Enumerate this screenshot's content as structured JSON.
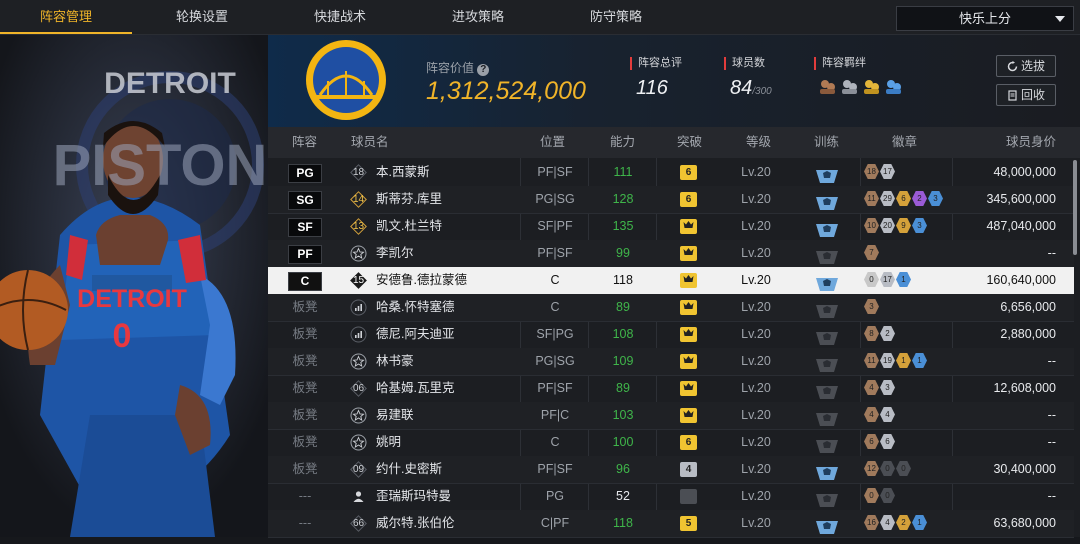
{
  "nav": {
    "tabs": [
      {
        "label": "阵容管理",
        "active": true
      },
      {
        "label": "轮换设置",
        "active": false
      },
      {
        "label": "快捷战术",
        "active": false
      },
      {
        "label": "进攻策略",
        "active": false
      },
      {
        "label": "防守策略",
        "active": false
      }
    ],
    "dropdown_value": "快乐上分"
  },
  "header": {
    "value_label": "阵容价值",
    "value": "1,312,524,000",
    "rating_label": "阵容总评",
    "rating": "116",
    "players_label": "球员数",
    "players": "84",
    "players_max": "/300",
    "bond_label": "阵容羁绊",
    "btn_select": "选拔",
    "btn_recycle": "回收"
  },
  "table": {
    "headers": [
      "阵容",
      "球员名",
      "位置",
      "能力",
      "突破",
      "等级",
      "训练",
      "徽章",
      "球员身价"
    ],
    "rows": [
      {
        "slot": "PG",
        "num": "18",
        "name": "本.西蒙斯",
        "pos": "PF|SF",
        "ability": "111",
        "break": "6",
        "level": "Lv.20",
        "train": true,
        "badges": [
          [
            "18",
            "#a07a5c"
          ],
          [
            "17",
            "#b8bcc4"
          ]
        ],
        "salary": "48,000,000"
      },
      {
        "slot": "SG",
        "num": "14",
        "name": "斯蒂芬.库里",
        "pos": "PG|SG",
        "ability": "128",
        "break": "6",
        "level": "Lv.20",
        "train": true,
        "badges": [
          [
            "11",
            "#a07a5c"
          ],
          [
            "29",
            "#b8bcc4"
          ],
          [
            "6",
            "#d4a13a"
          ],
          [
            "2",
            "#9a5bd6"
          ],
          [
            "3",
            "#4a8fd6"
          ]
        ],
        "salary": "345,600,000"
      },
      {
        "slot": "SF",
        "num": "13",
        "name": "凯文.杜兰特",
        "pos": "SF|PF",
        "ability": "135",
        "break": "crown",
        "level": "Lv.20",
        "train": true,
        "badges": [
          [
            "10",
            "#a07a5c"
          ],
          [
            "20",
            "#b8bcc4"
          ],
          [
            "9",
            "#d4a13a"
          ],
          [
            "3",
            "#4a8fd6"
          ]
        ],
        "salary": "487,040,000"
      },
      {
        "slot": "PF",
        "num": "star",
        "name": "李凯尔",
        "pos": "PF|SF",
        "ability": "99",
        "break": "crown",
        "level": "Lv.20",
        "train": false,
        "badges": [
          [
            "7",
            "#a07a5c"
          ]
        ],
        "salary": "--"
      },
      {
        "slot": "C",
        "num": "15",
        "name": "安德鲁.德拉蒙德",
        "pos": "C",
        "ability": "118",
        "break": "crown",
        "level": "Lv.20",
        "train": true,
        "badges": [
          [
            "0",
            "#c8c8c8"
          ],
          [
            "17",
            "#b8bcc4"
          ],
          [
            "1",
            "#4a8fd6"
          ]
        ],
        "salary": "160,640,000",
        "selected": true
      },
      {
        "slot": "板凳",
        "num": "bars",
        "name": "哈桑.怀特塞德",
        "pos": "C",
        "ability": "89",
        "break": "crown",
        "level": "Lv.20",
        "train": false,
        "badges": [
          [
            "3",
            "#a07a5c"
          ]
        ],
        "salary": "6,656,000"
      },
      {
        "slot": "板凳",
        "num": "bars",
        "name": "德尼.阿夫迪亚",
        "pos": "SF|PG",
        "ability": "108",
        "break": "crown",
        "level": "Lv.20",
        "train": false,
        "badges": [
          [
            "8",
            "#a07a5c"
          ],
          [
            "2",
            "#b8bcc4"
          ]
        ],
        "salary": "2,880,000"
      },
      {
        "slot": "板凳",
        "num": "star",
        "name": "林书豪",
        "pos": "PG|SG",
        "ability": "109",
        "break": "crown",
        "level": "Lv.20",
        "train": false,
        "badges": [
          [
            "11",
            "#a07a5c"
          ],
          [
            "19",
            "#b8bcc4"
          ],
          [
            "1",
            "#d4a13a"
          ],
          [
            "1",
            "#4a8fd6"
          ]
        ],
        "salary": "--"
      },
      {
        "slot": "板凳",
        "num": "06",
        "name": "哈基姆.瓦里克",
        "pos": "PF|SF",
        "ability": "89",
        "break": "crown",
        "level": "Lv.20",
        "train": false,
        "badges": [
          [
            "4",
            "#a07a5c"
          ],
          [
            "3",
            "#b8bcc4"
          ]
        ],
        "salary": "12,608,000"
      },
      {
        "slot": "板凳",
        "num": "star",
        "name": "易建联",
        "pos": "PF|C",
        "ability": "103",
        "break": "crown",
        "level": "Lv.20",
        "train": false,
        "badges": [
          [
            "4",
            "#a07a5c"
          ],
          [
            "4",
            "#b8bcc4"
          ]
        ],
        "salary": "--"
      },
      {
        "slot": "板凳",
        "num": "star",
        "name": "姚明",
        "pos": "C",
        "ability": "100",
        "break": "6",
        "level": "Lv.20",
        "train": false,
        "badges": [
          [
            "6",
            "#a07a5c"
          ],
          [
            "6",
            "#b8bcc4"
          ]
        ],
        "salary": "--"
      },
      {
        "slot": "板凳",
        "num": "09",
        "name": "约什.史密斯",
        "pos": "PF|SF",
        "ability": "96",
        "break": "4",
        "level": "Lv.20",
        "train": true,
        "badges": [
          [
            "12",
            "#a07a5c"
          ],
          [
            "0",
            "#4b4e54"
          ],
          [
            "0",
            "#4b4e54"
          ]
        ],
        "salary": "30,400,000"
      },
      {
        "slot": "---",
        "num": "person",
        "name": "歪瑞斯玛特曼",
        "pos": "PG",
        "ability": "52",
        "break": "none",
        "level": "Lv.20",
        "train": false,
        "badges": [
          [
            "0",
            "#a07a5c"
          ],
          [
            "0",
            "#4b4e54"
          ]
        ],
        "salary": "--"
      },
      {
        "slot": "---",
        "num": "66",
        "name": "威尔特.张伯伦",
        "pos": "C|PF",
        "ability": "118",
        "break": "5",
        "level": "Lv.20",
        "train": true,
        "badges": [
          [
            "16",
            "#a07a5c"
          ],
          [
            "4",
            "#b8bcc4"
          ],
          [
            "2",
            "#d4a13a"
          ],
          [
            "1",
            "#4a8fd6"
          ]
        ],
        "salary": "63,680,000"
      }
    ]
  },
  "colors": {
    "accent": "#f0b429",
    "ability_green": "#3fb54a",
    "rank_red": "#e23c3c"
  }
}
